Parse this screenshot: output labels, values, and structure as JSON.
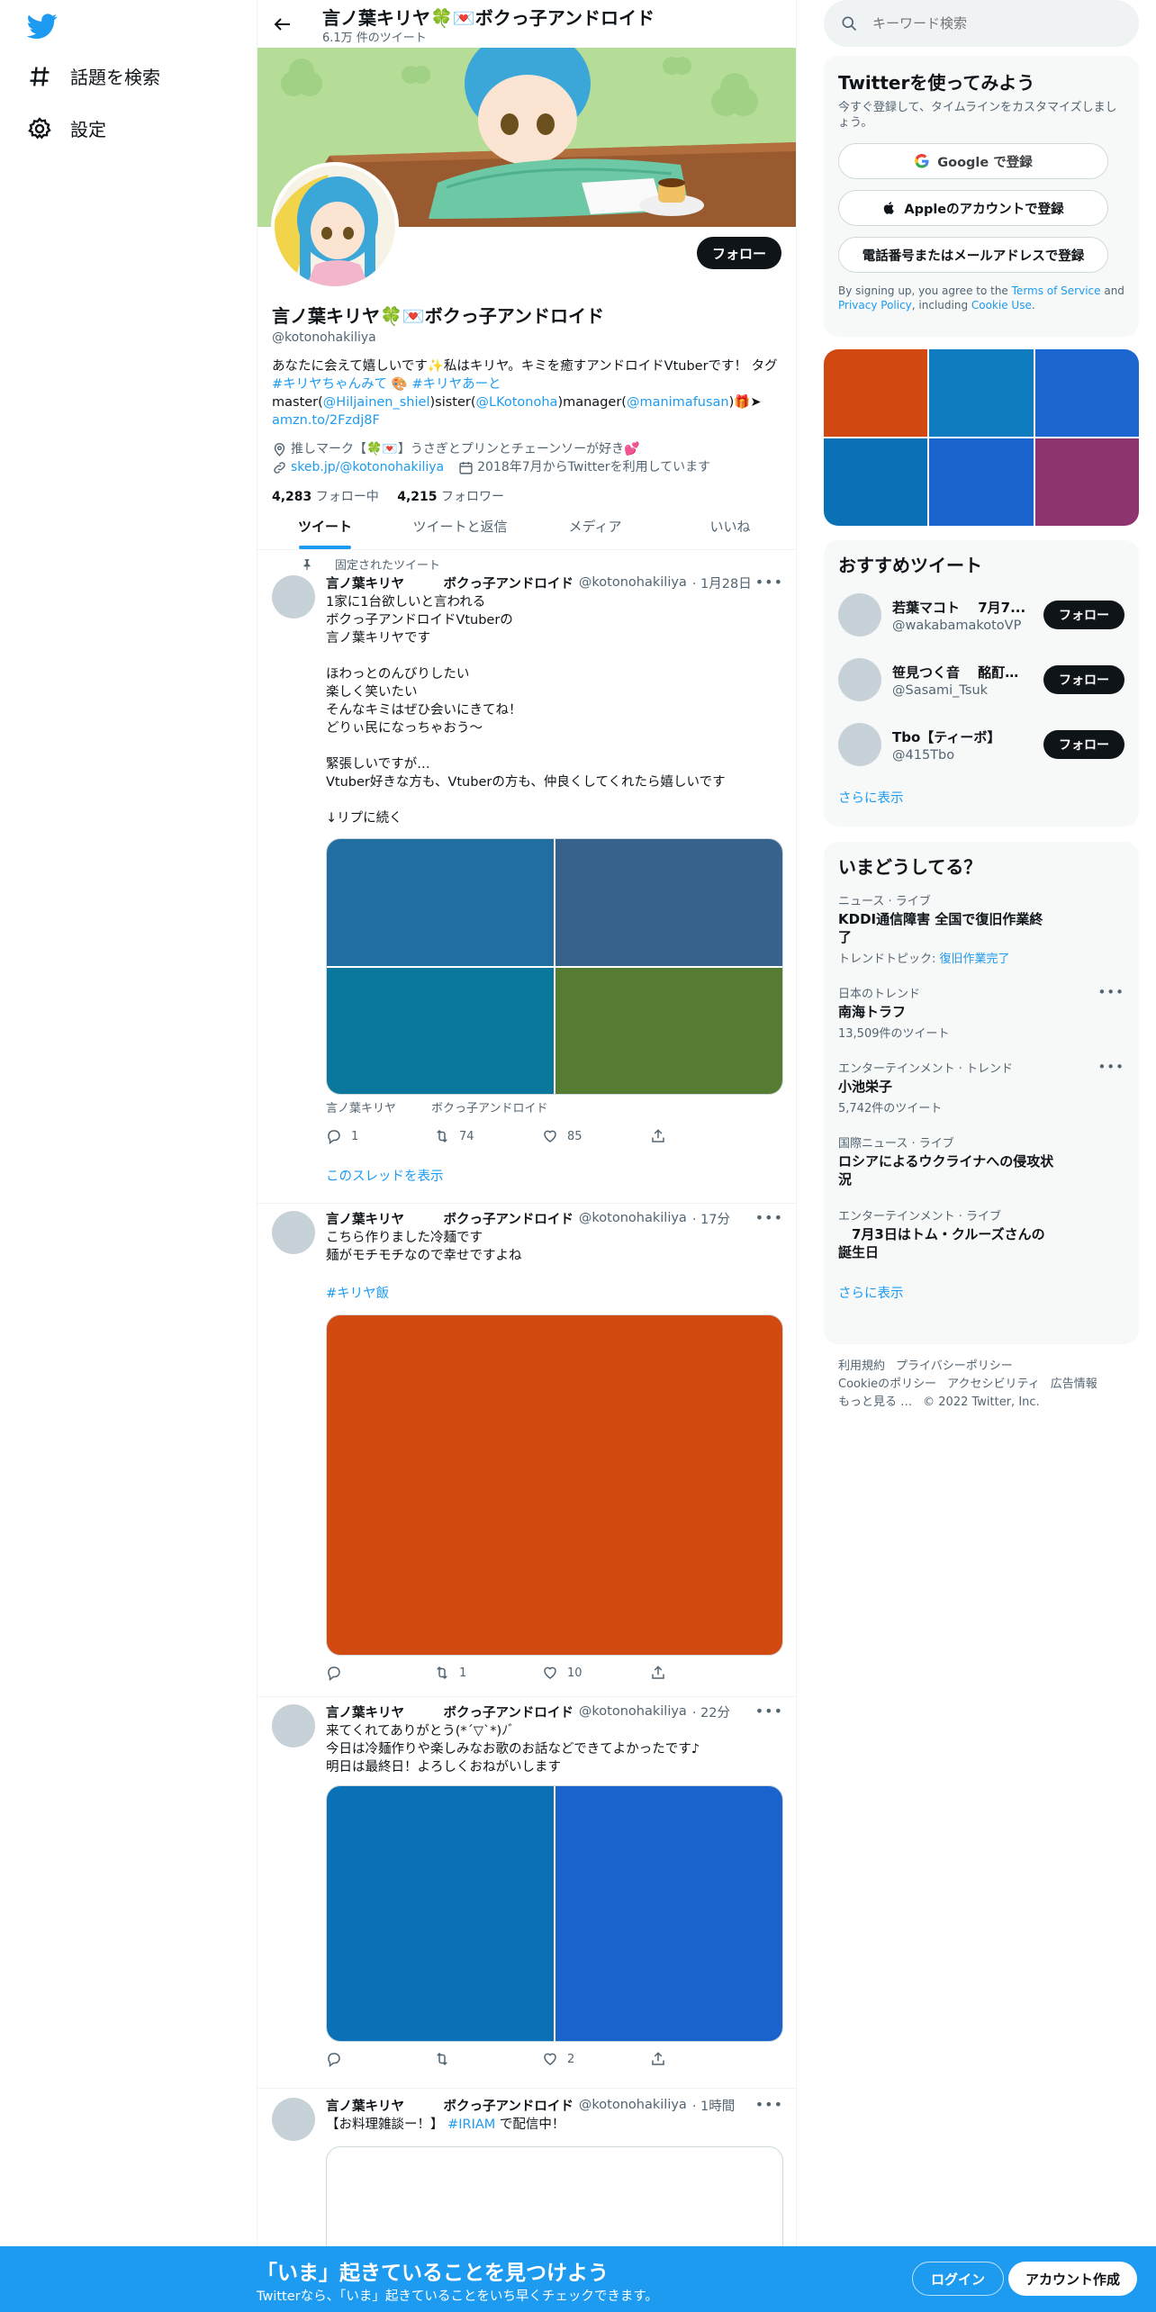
{
  "nav": {
    "explore_label": "話題を検索",
    "settings_label": "設定"
  },
  "profile": {
    "display_name": "言ノ葉キリヤ🍀💌ボクっ子アンドロイド",
    "tweet_count": "6.1万 件のツイート",
    "handle": "@kotonohakiliya",
    "follow_label": "フォロー",
    "bio_1": "あなたに会えて嬉しいです✨私はキリヤ。キミを癒すアンドロイドVtuberです！ タグ ",
    "bio_tag1": "#キリヤちゃんみて",
    "bio_2": " 🎨 ",
    "bio_tag2": "#キリヤあーと",
    "bio_3": " master(",
    "bio_link1": "@Hiljainen_shiel",
    "bio_4": ")sister(",
    "bio_link2": "@LKotonoha",
    "bio_5": ")manager(",
    "bio_link3": "@manimafusan",
    "bio_6": ")🎁➤ ",
    "bio_link4": "amzn.to/2Fzdj8F",
    "location": "推しマーク【🍀💌】うさぎとプリンとチェーンソーが好き💕",
    "website": "skeb.jp/@kotonohakiliya",
    "joined": "2018年7月からTwitterを利用しています",
    "following_count": "4,283",
    "following_label": "フォロー中",
    "followers_count": "4,215",
    "followers_label": "フォロワー"
  },
  "tabs": [
    "ツイート",
    "ツイートと返信",
    "メディア",
    "いいね"
  ],
  "tweets": [
    {
      "pinned_label": "固定されたツイート",
      "name": "言ノ葉キリヤ　　　ボクっ子アンドロイド",
      "handle": "@kotonohakiliya",
      "time": "· 1月28日",
      "text": "1家に1台欲しいと言われる\nボクっ子アンドロイドVtuberの\n言ノ葉キリヤです\n\nほわっとのんびりしたい\n楽しく笑いたい\nそんなキミはぜひ会いにきてね！\nどりぃ民になっちゃおう～\n\n緊張しいですが…\nVtuber好きな方も、Vtuberの方も、仲良くしてくれたら嬉しいです\n\n↓リプに続く",
      "media_caption": "言ノ葉キリヤ　　　ボクっ子アンドロイド",
      "replies": "1",
      "retweets": "74",
      "likes": "85",
      "thread_label": "このスレッドを表示",
      "media_colors": [
        "#236ea0",
        "#36628c",
        "#09789c",
        "#567c33"
      ]
    },
    {
      "name": "言ノ葉キリヤ　　　ボクっ子アンドロイド",
      "handle": "@kotonohakiliya",
      "time": "· 17分",
      "text": "こちら作りました冷麺です\n麺がモチモチなので幸せですよね",
      "hashtag": "#キリヤ飯",
      "replies": "",
      "retweets": "1",
      "likes": "10",
      "media_colors": [
        "#d24a10"
      ]
    },
    {
      "name": "言ノ葉キリヤ　　　ボクっ子アンドロイド",
      "handle": "@kotonohakiliya",
      "time": "· 22分",
      "text": "来てくれてありがとう(*´▽`*)ﾉﾞ\n今日は冷麺作りや楽しみなお歌のお話などできてよかったです♪\n明日は最終日！よろしくおねがいします",
      "replies": "",
      "retweets": "",
      "likes": "2",
      "media_colors": [
        "#0a71b6",
        "#1a62cc"
      ]
    },
    {
      "name": "言ノ葉キリヤ　　　ボクっ子アンドロイド",
      "handle": "@kotonohakiliya",
      "time": "· 1時間",
      "text_1": "【お料理雑談ー！】 ",
      "hashtag": "#IRIAM",
      "text_2": " で配信中！"
    }
  ],
  "right": {
    "search_placeholder": "キーワード検索",
    "signup_card": {
      "title": "Twitterを使ってみよう",
      "subtitle": "今すぐ登録して、タイムラインをカスタマイズしましょう。",
      "google_label": "Google で登録",
      "apple_label": "Appleのアカウントで登録",
      "phone_label": "電話番号またはメールアドレスで登録",
      "legal_1": "By signing up, you agree to the ",
      "tos": "Terms of Service",
      "legal_2": " and ",
      "privacy": "Privacy Policy",
      "legal_3": ", including ",
      "cookie": "Cookie Use",
      "legal_4": "."
    },
    "photo_colors": [
      "#d14910",
      "#0e7cbe",
      "#1b66cf",
      "#0a71b6",
      "#1a62cc",
      "#8e3570"
    ],
    "recommend": {
      "title": "おすすめツイート",
      "users": [
        {
          "name": "若葉マコト　 7月7...",
          "handle": "@wakabamakotoVP",
          "btn": "フォロー"
        },
        {
          "name": "笹見つく音　 酩酊O...",
          "handle": "@Sasami_Tsuk",
          "btn": "フォロー"
        },
        {
          "name": "Tbo【ティーボ】",
          "handle": "@415Tbo",
          "btn": "フォロー"
        }
      ],
      "more": "さらに表示"
    },
    "trends": {
      "title": "いまどうしてる？",
      "items": [
        {
          "cat": "ニュース · ライブ",
          "title": "KDDI通信障害 全国で復旧作業終了",
          "sub_label": "トレンドトピック: ",
          "sub_link": "復旧作業完了"
        },
        {
          "cat": "日本のトレンド",
          "title": "南海トラフ",
          "sub": "13,509件のツイート"
        },
        {
          "cat": "エンターテインメント · トレンド",
          "title": "小池栄子",
          "sub": "5,742件のツイート"
        },
        {
          "cat": "国際ニュース · ライブ",
          "title": "ロシアによるウクライナへの侵攻状況"
        },
        {
          "cat": "エンターテインメント · ライブ",
          "title": "　7月3日はトム・クルーズさんの誕生日"
        }
      ],
      "more": "さらに表示"
    },
    "footer": [
      "利用規約",
      "プライバシーポリシー",
      "Cookieのポリシー",
      "アクセシビリティ",
      "広告情報",
      "もっと見る …",
      "© 2022 Twitter, Inc."
    ]
  },
  "bottom": {
    "headline": "「いま」起きていることを見つけよう",
    "sub": "Twitterなら、「いま」起きていることをいち早くチェックできます。",
    "login": "ログイン",
    "signup": "アカウント作成"
  }
}
